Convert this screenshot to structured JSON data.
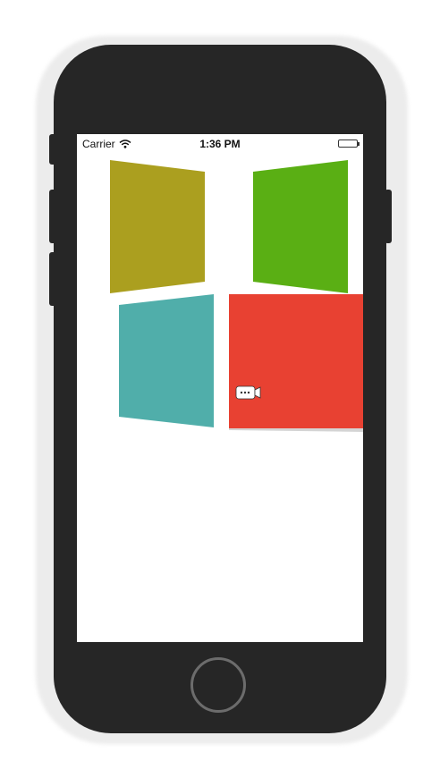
{
  "status_bar": {
    "carrier": "Carrier",
    "time": "1:36 PM",
    "wifi_icon": "wifi-icon",
    "battery_icon": "battery-icon"
  },
  "tiles": [
    {
      "name": "tile-olive",
      "color": "#ab9f1f"
    },
    {
      "name": "tile-green",
      "color": "#5aaf14"
    },
    {
      "name": "tile-teal",
      "color": "#50aeaa"
    },
    {
      "name": "tile-red",
      "color": "#e84132"
    }
  ],
  "overlay": {
    "icon": "video-camera-icon"
  },
  "device": {
    "body_color": "#262626",
    "home_button_icon": "home-button"
  }
}
